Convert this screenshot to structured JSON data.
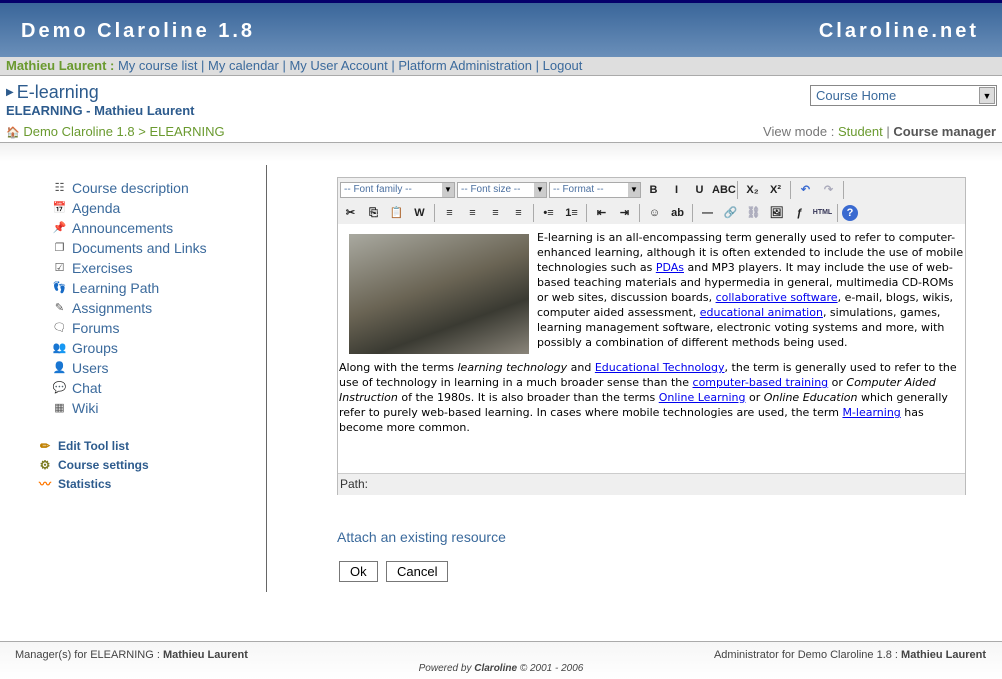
{
  "banner": {
    "site_name": "Demo Claroline 1.8",
    "right_link": "Claroline.net"
  },
  "nav": {
    "user": "Mathieu Laurent :",
    "links": [
      "My course list",
      "My calendar",
      "My User Account",
      "Platform Administration",
      "Logout"
    ]
  },
  "course": {
    "title": "E-learning",
    "subtitle": "ELEARNING - Mathieu Laurent"
  },
  "breadcrumb": {
    "home": "Demo Claroline 1.8",
    "sep": ">",
    "current": "ELEARNING"
  },
  "course_select": {
    "value": "Course Home"
  },
  "view_mode": {
    "label": "View mode :",
    "student": "Student",
    "sep": "|",
    "manager": "Course manager"
  },
  "tools": [
    {
      "label": "Course description",
      "icon": "☷"
    },
    {
      "label": "Agenda",
      "icon": "📅"
    },
    {
      "label": "Announcements",
      "icon": "📌"
    },
    {
      "label": "Documents and Links",
      "icon": "❐"
    },
    {
      "label": "Exercises",
      "icon": "☑"
    },
    {
      "label": "Learning Path",
      "icon": "👣"
    },
    {
      "label": "Assignments",
      "icon": "✎"
    },
    {
      "label": "Forums",
      "icon": "🗨"
    },
    {
      "label": "Groups",
      "icon": "👥"
    },
    {
      "label": "Users",
      "icon": "👤"
    },
    {
      "label": "Chat",
      "icon": "💬"
    },
    {
      "label": "Wiki",
      "icon": "▦"
    }
  ],
  "admin_tools": [
    {
      "label": "Edit Tool list",
      "icon": "✏"
    },
    {
      "label": "Course settings",
      "icon": "⚙"
    },
    {
      "label": "Statistics",
      "icon": "〰"
    }
  ],
  "editor": {
    "font_family": "-- Font family --",
    "font_size": "-- Font size --",
    "format": "-- Format --",
    "toolbar1": [
      "B",
      "I",
      "U",
      "ABC",
      "|",
      "X₂",
      "X²",
      "|",
      "↶",
      "↷",
      "|"
    ],
    "toolbar2": [
      "✂",
      "⎘",
      "📋",
      "W",
      "|",
      "≡",
      "≡",
      "≡",
      "≡",
      "|",
      "•≡",
      "1≡",
      "|",
      "⇤",
      "⇥",
      "|",
      "☺",
      "ab",
      "|",
      "—",
      "🔗",
      "⛓",
      "🖼",
      "ƒ",
      "HTML",
      "|",
      "?"
    ],
    "paragraphs": [
      [
        {
          "t": " E-learning is an all-encompassing term generally used to refer to computer-enhanced learning, although it is often extended to include the use of mobile technologies such as "
        },
        {
          "t": "PDAs",
          "link": true
        },
        {
          "t": " and MP3 players. It may include the use of web-based teaching materials and hypermedia in general, multimedia CD-ROMs or web sites, discussion boards, "
        },
        {
          "t": "collaborative software",
          "link": true
        },
        {
          "t": ", e-mail, blogs, wikis, computer aided assessment, "
        },
        {
          "t": "educational animation",
          "link": true
        },
        {
          "t": ", simulations, games, learning management software, electronic voting systems and more, with possibly a combination of different methods being used."
        }
      ],
      [
        {
          "t": "Along with the terms "
        },
        {
          "t": "learning technology",
          "em": true
        },
        {
          "t": " and "
        },
        {
          "t": "Educational Technology",
          "link": true
        },
        {
          "t": ", the term is generally used to refer to the use of technology in learning in a much broader sense than the "
        },
        {
          "t": "computer-based training",
          "link": true
        },
        {
          "t": " or "
        },
        {
          "t": "Computer Aided Instruction",
          "em": true
        },
        {
          "t": " of the 1980s. It is also broader than the terms "
        },
        {
          "t": "Online Learning",
          "link": true
        },
        {
          "t": " or "
        },
        {
          "t": "Online Education",
          "em": true
        },
        {
          "t": " which generally refer to purely web-based learning. In cases where mobile technologies are used, the term "
        },
        {
          "t": "M-learning",
          "link": true
        },
        {
          "t": " has become more common."
        }
      ]
    ],
    "path_label": "Path:"
  },
  "attach_link": "Attach an existing resource",
  "buttons": {
    "ok": "Ok",
    "cancel": "Cancel"
  },
  "footer": {
    "managers_label": "Manager(s) for ELEARNING :",
    "managers": "Mathieu Laurent",
    "admin_label": "Administrator for Demo Claroline 1.8 :",
    "admin": "Mathieu Laurent",
    "powered_pre": "Powered by",
    "powered_brand": "Claroline",
    "powered_post": "© 2001 - 2006"
  }
}
